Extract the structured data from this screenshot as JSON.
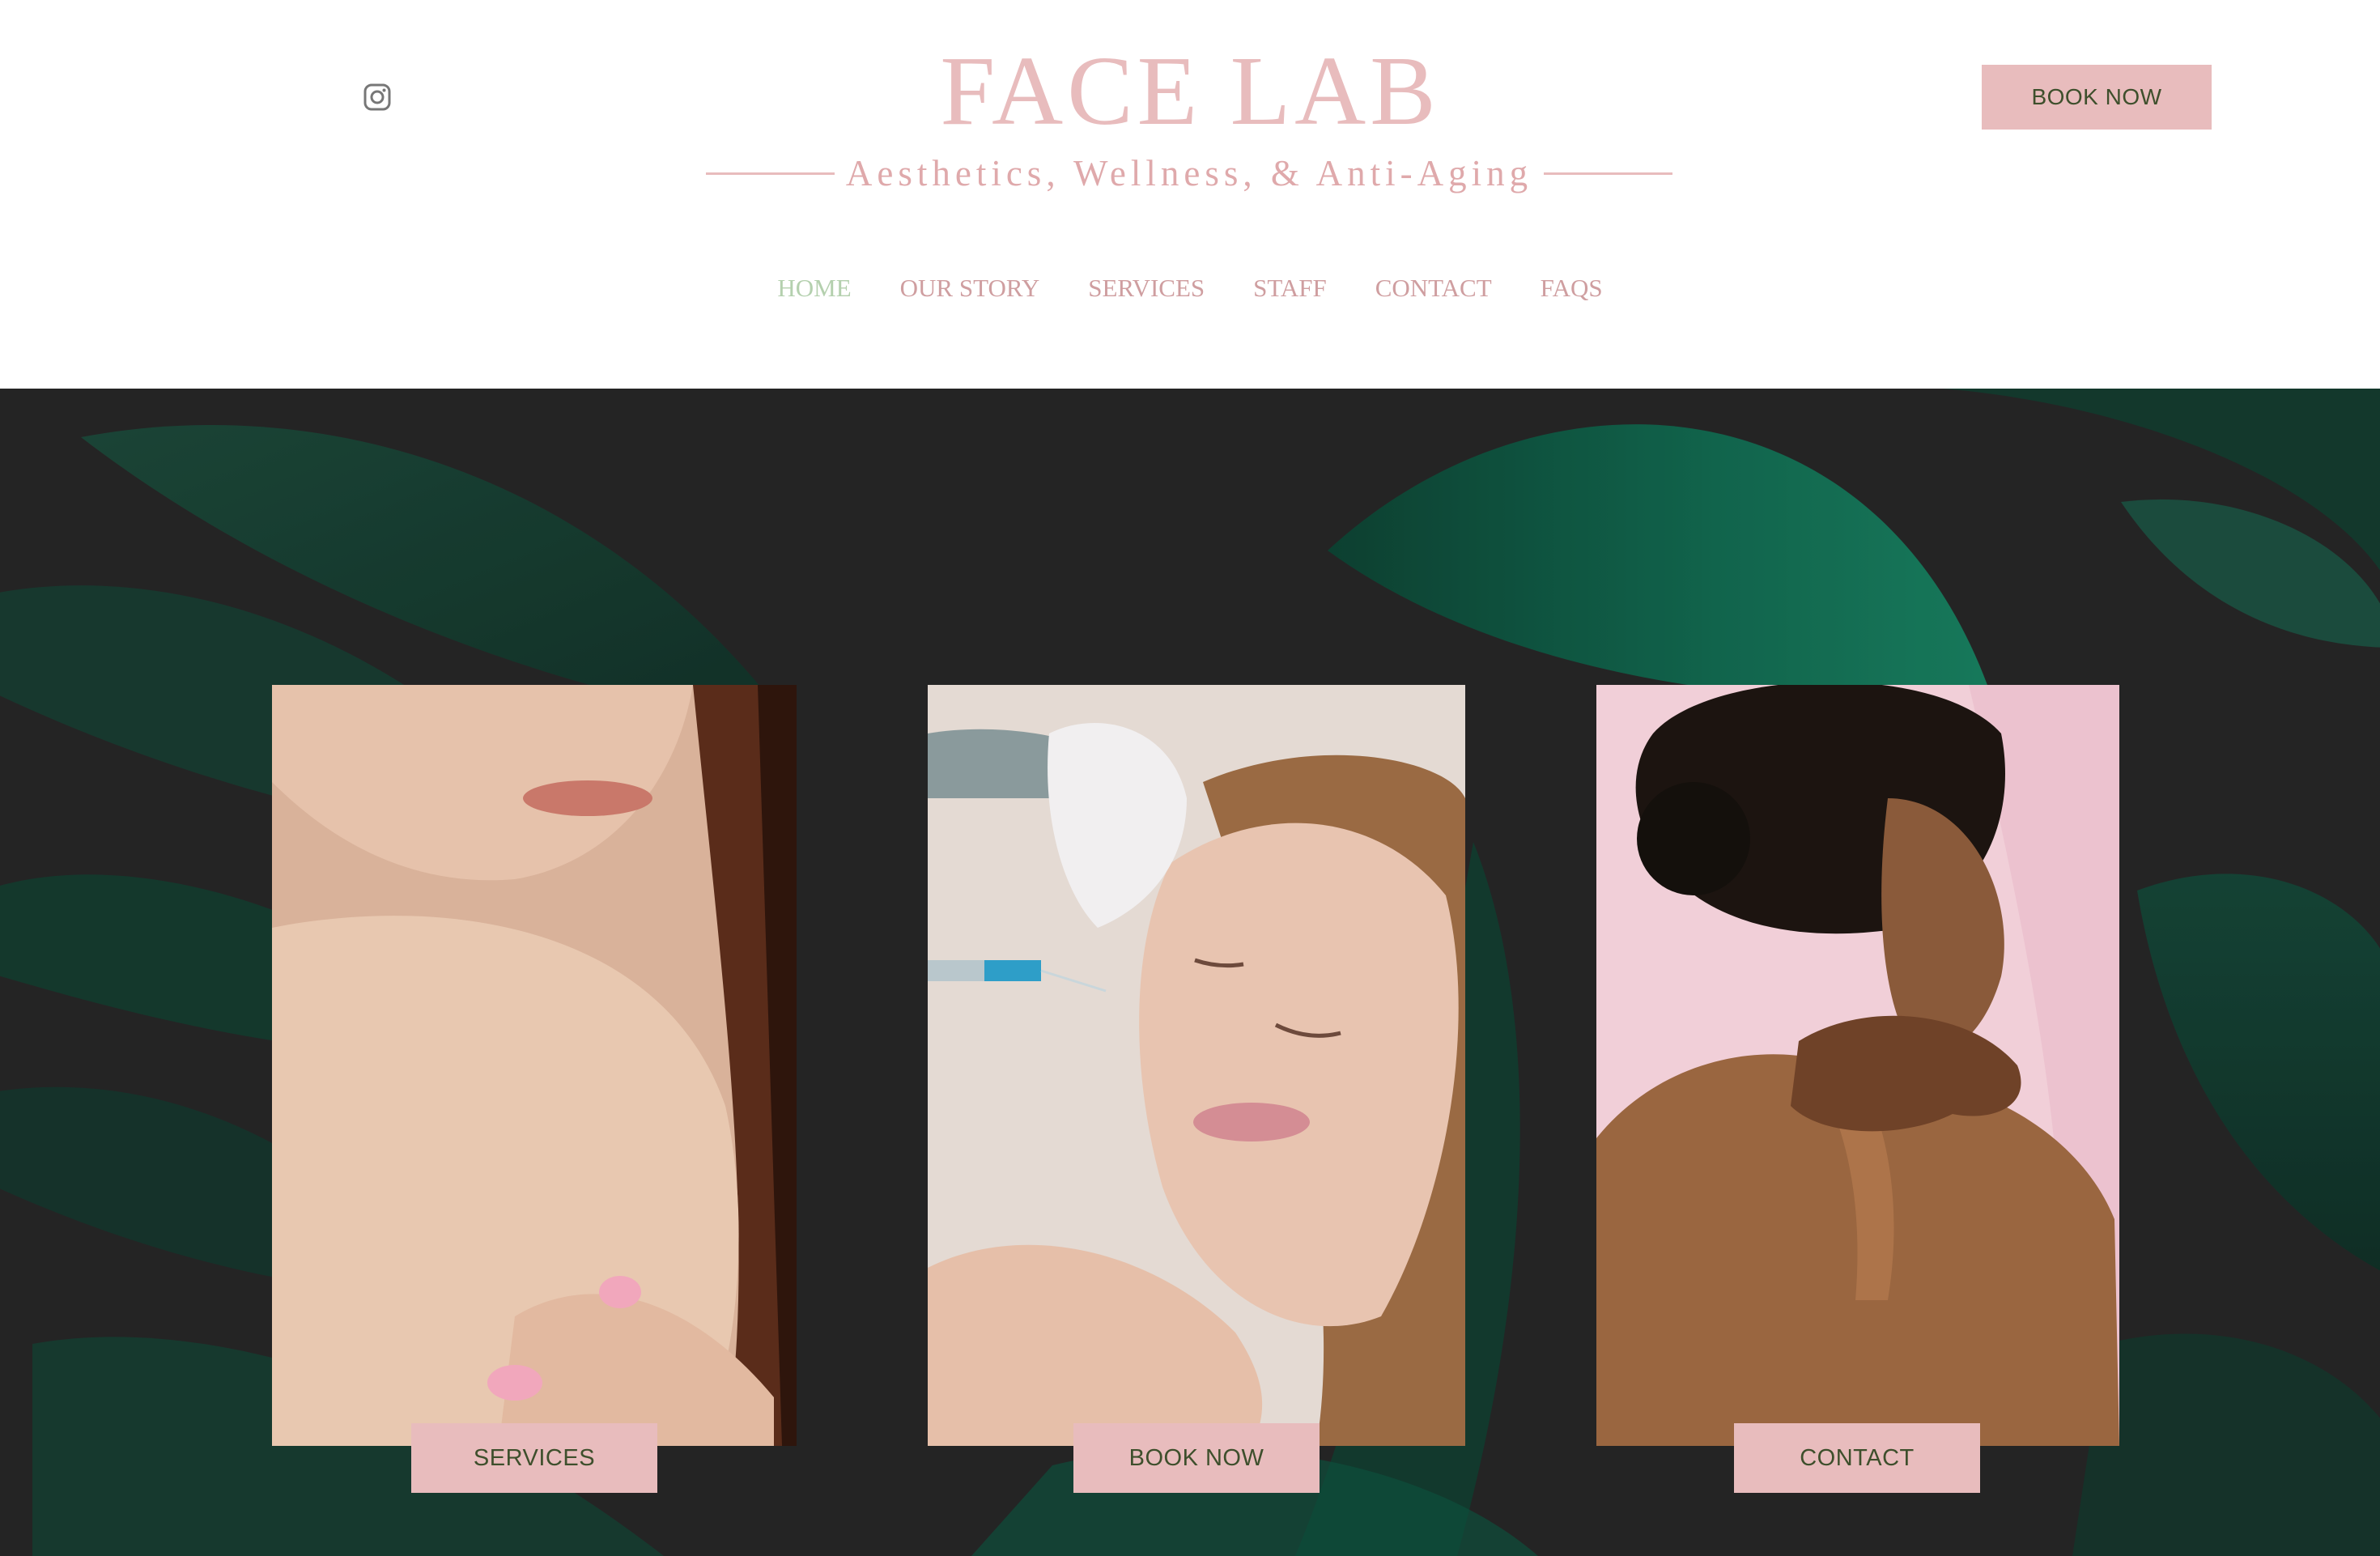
{
  "header": {
    "brand_title": "FACE LAB",
    "tagline": "Aesthetics, Wellness, & Anti-Aging",
    "book_now_label": "BOOK NOW",
    "social_icon": "instagram-icon"
  },
  "nav": {
    "items": [
      {
        "label": "HOME",
        "active": true
      },
      {
        "label": "OUR STORY",
        "active": false
      },
      {
        "label": "SERVICES",
        "active": false
      },
      {
        "label": "STAFF",
        "active": false
      },
      {
        "label": "CONTACT",
        "active": false
      },
      {
        "label": "FAQS",
        "active": false
      }
    ]
  },
  "hero": {
    "cards": [
      {
        "photo": "woman-shoulder-photo",
        "button_label": "SERVICES"
      },
      {
        "photo": "injection-treatment-photo",
        "button_label": "BOOK NOW"
      },
      {
        "photo": "woman-back-photo",
        "button_label": "CONTACT"
      }
    ]
  },
  "colors": {
    "brand_pink": "#e8bcbd",
    "button_text": "#3e4f2c",
    "nav_text": "#cf9ea0",
    "nav_active": "#b4d0ae",
    "hero_background": "#2a2a2a",
    "leaf_green": "#0f6a4e"
  }
}
